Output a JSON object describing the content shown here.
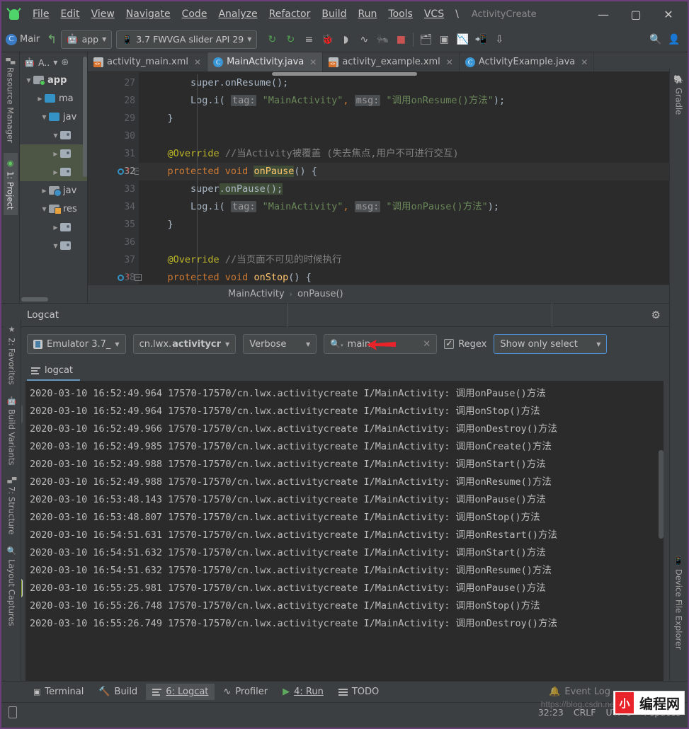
{
  "window": {
    "title": "ActivityCreate",
    "minimize_label": "—",
    "maximize_label": "▢",
    "close_label": "✕"
  },
  "menu": {
    "items": [
      {
        "label": "File"
      },
      {
        "label": "Edit"
      },
      {
        "label": "View"
      },
      {
        "label": "Navigate"
      },
      {
        "label": "Code"
      },
      {
        "label": "Analyze"
      },
      {
        "label": "Refactor"
      },
      {
        "label": "Build"
      },
      {
        "label": "Run"
      },
      {
        "label": "Tools"
      },
      {
        "label": "VCS"
      },
      {
        "label": "\\"
      }
    ]
  },
  "toolbar": {
    "module_letter": "C",
    "module_name": "Mair",
    "app_config": "app",
    "device": "3.7  FWVGA slider API 29",
    "icons": [
      "run-icon",
      "debug-attach-icon",
      "apply-changes-icon",
      "debug-icon",
      "stop-paused-icon",
      "profiler-icon",
      "attach-debugger-icon",
      "stop-icon",
      "sdk-manager-icon",
      "avd-manager-icon",
      "layout-inspector-icon",
      "device-explorer-icon",
      "sync-gradle-icon",
      "search-icon",
      "profile-icon"
    ]
  },
  "left_stripe": {
    "tabs": [
      {
        "label": "Resource Manager",
        "icon": "resource-manager-icon",
        "active": false
      },
      {
        "label": "1: Project",
        "icon": "project-icon",
        "active": true
      },
      {
        "label": "2: Favorites",
        "icon": "star-icon",
        "active": false
      },
      {
        "label": "Build Variants",
        "icon": "android-icon",
        "active": false
      },
      {
        "label": "7: Structure",
        "icon": "structure-icon",
        "active": false
      },
      {
        "label": "Layout Captures",
        "icon": "layout-captures-icon",
        "active": false
      }
    ]
  },
  "right_stripe": {
    "tabs": [
      {
        "label": "Gradle",
        "icon": "gradle-elephant-icon"
      },
      {
        "label": "Device File Explorer",
        "icon": "device-phone-icon"
      }
    ]
  },
  "project": {
    "header_label": "A..",
    "tree": [
      {
        "depth": 0,
        "arrow": "▼",
        "icon": "module-folder-icon",
        "label": "app",
        "bold": true,
        "selected": false
      },
      {
        "depth": 1,
        "arrow": "▶",
        "icon": "folder-icon",
        "label": "ma",
        "bold": false,
        "selected": false
      },
      {
        "depth": 2,
        "arrow": "▼",
        "icon": "folder-icon",
        "label": "jav",
        "bold": false,
        "selected": false
      },
      {
        "depth": 3,
        "arrow": "▼",
        "icon": "package-icon",
        "label": "",
        "bold": false,
        "selected": false
      },
      {
        "depth": 4,
        "arrow": "▶",
        "icon": "package-icon",
        "label": "",
        "bold": false,
        "selected": true
      },
      {
        "depth": 4,
        "arrow": "▶",
        "icon": "package-icon",
        "label": "",
        "bold": false,
        "selected": true
      },
      {
        "depth": 2,
        "arrow": "▶",
        "icon": "java-gen-folder-icon",
        "label": "jav",
        "bold": false,
        "selected": false
      },
      {
        "depth": 2,
        "arrow": "▼",
        "icon": "res-folder-icon",
        "label": "res",
        "bold": false,
        "selected": false
      },
      {
        "depth": 3,
        "arrow": "▶",
        "icon": "package-icon",
        "label": "",
        "bold": false,
        "selected": false
      },
      {
        "depth": 3,
        "arrow": "▼",
        "icon": "package-icon",
        "label": "",
        "bold": false,
        "selected": false
      }
    ]
  },
  "editor": {
    "tabs": [
      {
        "label": "activity_main.xml",
        "icon": "xml-file-icon",
        "active": false
      },
      {
        "label": "MainActivity.java",
        "icon": "java-class-icon",
        "active": true
      },
      {
        "label": "activity_example.xml",
        "icon": "xml-file-icon",
        "active": false
      },
      {
        "label": "ActivityExample.java",
        "icon": "java-class-icon",
        "active": false
      }
    ],
    "lines": [
      {
        "num": "27",
        "segments": [
          {
            "t": "            super",
            "c": "punct"
          },
          {
            "t": ".",
            "c": "punct"
          },
          {
            "t": "onResume",
            "c": "punct"
          },
          {
            "t": "();",
            "c": "punct"
          }
        ],
        "gutter": "",
        "fold": ""
      },
      {
        "num": "28",
        "segments": [],
        "gutter": "",
        "fold": ""
      },
      {
        "num": "29",
        "segments": [],
        "gutter": "",
        "fold": "open"
      },
      {
        "num": "30",
        "segments": [],
        "gutter": "",
        "fold": ""
      },
      {
        "num": "31",
        "segments": [],
        "gutter": "",
        "fold": ""
      },
      {
        "num": "32",
        "segments": [],
        "gutter": "override",
        "fold": "closed",
        "current": true
      },
      {
        "num": "33",
        "segments": [],
        "gutter": "",
        "fold": ""
      },
      {
        "num": "34",
        "segments": [],
        "gutter": "",
        "fold": ""
      },
      {
        "num": "35",
        "segments": [],
        "gutter": "",
        "fold": "open"
      },
      {
        "num": "36",
        "segments": [],
        "gutter": "",
        "fold": ""
      },
      {
        "num": "37",
        "segments": [],
        "gutter": "",
        "fold": ""
      },
      {
        "num": "38",
        "segments": [],
        "gutter": "override",
        "fold": "closed"
      }
    ],
    "code": {
      "l27_super": "super",
      "l27_call": ".onResume();",
      "l28_log": "Log.i(",
      "l28_tag_label": "tag:",
      "l28_tag_val": "\"MainActivity\"",
      "l28_comma": ",",
      "l28_msg_label": "msg:",
      "l28_msg_val": "\"调用onResume()方法\"",
      "l28_end": ");",
      "l29_brace": "}",
      "l31_override": "@Override",
      "l31_comment": "//当Activity被覆盖 (失去焦点,用户不可进行交互)",
      "l32_kw": "protected void",
      "l32_name": "onPause",
      "l32_rest": "() {",
      "l33_super": "super",
      "l33_call": ".onPause();",
      "l34_log": "Log.i(",
      "l34_tag_label": "tag:",
      "l34_tag_val": "\"MainActivity\"",
      "l34_comma": ",",
      "l34_msg_label": "msg:",
      "l34_msg_val": "\"调用onPause()方法\"",
      "l34_end": ");",
      "l35_brace": "}",
      "l37_override": "@Override",
      "l37_comment": "//当页面不可见的时候执行",
      "l38_kw": "protected void",
      "l38_name": "onStop",
      "l38_rest": "() {"
    },
    "breadcrumb": {
      "class": "MainActivity",
      "separator": "›",
      "method": "onPause()"
    }
  },
  "logcat": {
    "panel_title": "Logcat",
    "settings_icon": "gear-icon",
    "minimize_icon": "minimize-icon",
    "device_select": "Emulator 3.7_",
    "device_icon": "device-icon",
    "process_select_prefix": "cn.lwx.",
    "process_select_bold": "activitycr",
    "level_select": "Verbose",
    "search_value": "main",
    "search_icon": "search-icon",
    "clear_icon": "clear-icon",
    "regex_label": "Regex",
    "regex_checked": true,
    "filter_select": "Show only select",
    "tab_label": "logcat",
    "tab_icon": "logcat-lines-icon",
    "side_tools": [
      {
        "name": "clear-logcat-icon",
        "glyph": "🗑",
        "selected": false
      },
      {
        "name": "scroll-to-end-icon",
        "glyph": "⬇",
        "selected": true
      },
      {
        "name": "up-arrow-icon",
        "glyph": "↑",
        "selected": false
      },
      {
        "name": "down-arrow-icon",
        "glyph": "↓",
        "selected": false
      },
      {
        "name": "soft-wrap-icon",
        "glyph": "≡",
        "selected": false
      },
      {
        "name": "print-icon",
        "glyph": "🖨",
        "selected": false
      },
      {
        "name": "restart-icon",
        "glyph": "↻",
        "selected": false
      },
      {
        "name": "settings-icon",
        "glyph": "⚙",
        "selected": false
      },
      {
        "name": "screenshot-icon",
        "glyph": "📷",
        "selected": false
      },
      {
        "name": "screen-record-icon",
        "glyph": "▶",
        "selected": false
      },
      {
        "name": "terminate-icon",
        "glyph": "■",
        "selected": false
      },
      {
        "name": "more-icon",
        "glyph": "»",
        "selected": false
      }
    ],
    "wrap_icon": "wrap-lines-icon",
    "rows": [
      {
        "date": "2020-03-10",
        "time": "16:52:49.964",
        "pid": "17570-17570",
        "pkg": "cn.lwx.activitycreate",
        "level_tag": "I/MainActivity:",
        "message": "调用onPause()方法"
      },
      {
        "date": "2020-03-10",
        "time": "16:52:49.964",
        "pid": "17570-17570",
        "pkg": "cn.lwx.activitycreate",
        "level_tag": "I/MainActivity:",
        "message": "调用onStop()方法"
      },
      {
        "date": "2020-03-10",
        "time": "16:52:49.966",
        "pid": "17570-17570",
        "pkg": "cn.lwx.activitycreate",
        "level_tag": "I/MainActivity:",
        "message": "调用onDestroy()方法"
      },
      {
        "date": "2020-03-10",
        "time": "16:52:49.985",
        "pid": "17570-17570",
        "pkg": "cn.lwx.activitycreate",
        "level_tag": "I/MainActivity:",
        "message": "调用onCreate()方法"
      },
      {
        "date": "2020-03-10",
        "time": "16:52:49.988",
        "pid": "17570-17570",
        "pkg": "cn.lwx.activitycreate",
        "level_tag": "I/MainActivity:",
        "message": "调用onStart()方法"
      },
      {
        "date": "2020-03-10",
        "time": "16:52:49.988",
        "pid": "17570-17570",
        "pkg": "cn.lwx.activitycreate",
        "level_tag": "I/MainActivity:",
        "message": "调用onResume()方法"
      },
      {
        "date": "2020-03-10",
        "time": "16:53:48.143",
        "pid": "17570-17570",
        "pkg": "cn.lwx.activitycreate",
        "level_tag": "I/MainActivity:",
        "message": "调用onPause()方法"
      },
      {
        "date": "2020-03-10",
        "time": "16:53:48.807",
        "pid": "17570-17570",
        "pkg": "cn.lwx.activitycreate",
        "level_tag": "I/MainActivity:",
        "message": "调用onStop()方法"
      },
      {
        "date": "2020-03-10",
        "time": "16:54:51.631",
        "pid": "17570-17570",
        "pkg": "cn.lwx.activitycreate",
        "level_tag": "I/MainActivity:",
        "message": "调用onRestart()方法"
      },
      {
        "date": "2020-03-10",
        "time": "16:54:51.632",
        "pid": "17570-17570",
        "pkg": "cn.lwx.activitycreate",
        "level_tag": "I/MainActivity:",
        "message": "调用onStart()方法"
      },
      {
        "date": "2020-03-10",
        "time": "16:54:51.632",
        "pid": "17570-17570",
        "pkg": "cn.lwx.activitycreate",
        "level_tag": "I/MainActivity:",
        "message": "调用onResume()方法"
      },
      {
        "date": "2020-03-10",
        "time": "16:55:25.981",
        "pid": "17570-17570",
        "pkg": "cn.lwx.activitycreate",
        "level_tag": "I/MainActivity:",
        "message": "调用onPause()方法"
      },
      {
        "date": "2020-03-10",
        "time": "16:55:26.748",
        "pid": "17570-17570",
        "pkg": "cn.lwx.activitycreate",
        "level_tag": "I/MainActivity:",
        "message": "调用onStop()方法"
      },
      {
        "date": "2020-03-10",
        "time": "16:55:26.749",
        "pid": "17570-17570",
        "pkg": "cn.lwx.activitycreate",
        "level_tag": "I/MainActivity:",
        "message": "调用onDestroy()方法"
      }
    ]
  },
  "bottom_bar": {
    "items": [
      {
        "label": "Terminal",
        "icon": "terminal-icon",
        "active": false,
        "mnemonic": ""
      },
      {
        "label": "Build",
        "icon": "build-hammer-icon",
        "active": false,
        "mnemonic": ""
      },
      {
        "label": "6: Logcat",
        "icon": "logcat-icon",
        "active": true,
        "mnemonic": "6"
      },
      {
        "label": "Profiler",
        "icon": "profiler-icon",
        "active": false,
        "mnemonic": ""
      },
      {
        "label": "4: Run",
        "icon": "run-icon",
        "active": false,
        "mnemonic": "4"
      },
      {
        "label": "TODO",
        "icon": "todo-icon",
        "active": false,
        "mnemonic": ""
      }
    ],
    "event_log_label": "Event Log"
  },
  "status_bar": {
    "caret": "32:23",
    "line_sep": "CRLF",
    "encoding": "UTF-8",
    "indent": "4 spaces",
    "device_icon": "phone-icon"
  },
  "watermark": {
    "url": "https://blog.csdn.net",
    "logo_mark": "小",
    "logo_text": "编程网"
  },
  "colors": {
    "accent_blue": "#4f8fd4",
    "android_green": "#4fd46b",
    "string_green": "#6a8759",
    "keyword_orange": "#cc7832",
    "annotation_yellow": "#bbb529",
    "comment_gray": "#808080",
    "editor_bg": "#2b2b2b",
    "panel_bg": "#3c3f41",
    "red_arrow": "#e8242a"
  }
}
